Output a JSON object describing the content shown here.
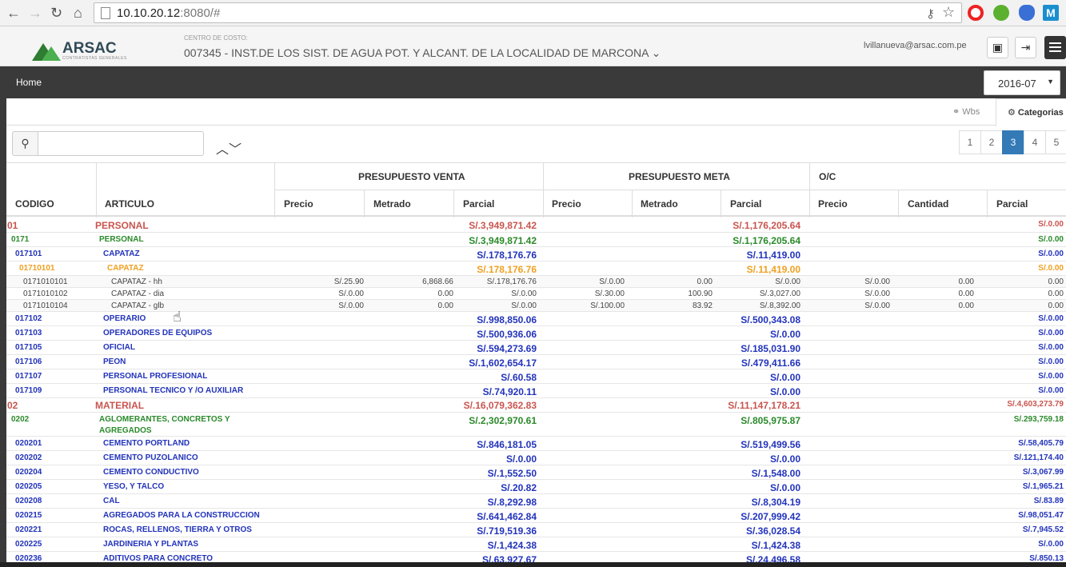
{
  "browser": {
    "url_host": "10.10.20.12",
    "url_rest": ":8080/#"
  },
  "header": {
    "logo_text": "ARSAC",
    "logo_sub": "CONTRATISTAS GENERALES",
    "cc_label": "CENTRO DE COSTO:",
    "cc_name": "007345 - INST.DE LOS SIST. DE AGUA POT. Y ALCANT. DE LA LOCALIDAD DE MARCONA ⌄",
    "email": "lvillanueva@arsac.com.pe"
  },
  "nav": {
    "home": "Home",
    "period": "2016-07"
  },
  "tabs": {
    "wbs": "Wbs",
    "categorias": "Categorias"
  },
  "search": {
    "placeholder": ""
  },
  "pager": [
    "1",
    "2",
    "3",
    "4",
    "5"
  ],
  "pager_active": "3",
  "columns": {
    "codigo": "CODIGO",
    "articulo": "ARTICULO",
    "group_venta": "PRESUPUESTO VENTA",
    "group_meta": "PRESUPUESTO META",
    "group_oc": "O/C",
    "precio": "Precio",
    "metrado": "Metrado",
    "parcial": "Parcial",
    "cantidad": "Cantidad"
  },
  "rows": [
    {
      "level": 1,
      "code": "01",
      "name": "PERSONAL",
      "v_parcial": "S/.3,949,871.42",
      "m_parcial": "S/.1,176,205.64",
      "oc_parcial": "S/.0.00"
    },
    {
      "level": 2,
      "code": "0171",
      "name": "PERSONAL",
      "v_parcial": "S/.3,949,871.42",
      "m_parcial": "S/.1,176,205.64",
      "oc_parcial": "S/.0.00"
    },
    {
      "level": 3,
      "code": "017101",
      "name": "CAPATAZ",
      "v_parcial": "S/.178,176.76",
      "m_parcial": "S/.11,419.00",
      "oc_parcial": "S/.0.00"
    },
    {
      "level": 4,
      "code": "01710101",
      "name": "CAPATAZ",
      "v_parcial": "S/.178,176.76",
      "m_parcial": "S/.11,419.00",
      "oc_parcial": "S/.0.00"
    },
    {
      "level": 5,
      "code": "0171010101",
      "name": "CAPATAZ - hh",
      "v_precio": "S/.25.90",
      "v_metrado": "6,868.66",
      "v_parcial": "S/.178,176.76",
      "m_precio": "S/.0.00",
      "m_metrado": "0.00",
      "m_parcial": "S/.0.00",
      "oc_precio": "S/.0.00",
      "oc_cantidad": "0.00",
      "oc_parcial": "0.00"
    },
    {
      "level": 5,
      "code": "0171010102",
      "name": "CAPATAZ - dia",
      "v_precio": "S/.0.00",
      "v_metrado": "0.00",
      "v_parcial": "S/.0.00",
      "m_precio": "S/.30.00",
      "m_metrado": "100.90",
      "m_parcial": "S/.3,027.00",
      "oc_precio": "S/.0.00",
      "oc_cantidad": "0.00",
      "oc_parcial": "0.00"
    },
    {
      "level": 5,
      "code": "0171010104",
      "name": "CAPATAZ - glb",
      "v_precio": "S/.0.00",
      "v_metrado": "0.00",
      "v_parcial": "S/.0.00",
      "m_precio": "S/.100.00",
      "m_metrado": "83.92",
      "m_parcial": "S/.8,392.00",
      "oc_precio": "S/.0.00",
      "oc_cantidad": "0.00",
      "oc_parcial": "0.00"
    },
    {
      "level": 3,
      "code": "017102",
      "name": "OPERARIO",
      "v_parcial": "S/.998,850.06",
      "m_parcial": "S/.500,343.08",
      "oc_parcial": "S/.0.00"
    },
    {
      "level": 3,
      "code": "017103",
      "name": "OPERADORES DE EQUIPOS",
      "v_parcial": "S/.500,936.06",
      "m_parcial": "S/.0.00",
      "oc_parcial": "S/.0.00"
    },
    {
      "level": 3,
      "code": "017105",
      "name": "OFICIAL",
      "v_parcial": "S/.594,273.69",
      "m_parcial": "S/.185,031.90",
      "oc_parcial": "S/.0.00"
    },
    {
      "level": 3,
      "code": "017106",
      "name": "PEON",
      "v_parcial": "S/.1,602,654.17",
      "m_parcial": "S/.479,411.66",
      "oc_parcial": "S/.0.00"
    },
    {
      "level": 3,
      "code": "017107",
      "name": "PERSONAL PROFESIONAL",
      "v_parcial": "S/.60.58",
      "m_parcial": "S/.0.00",
      "oc_parcial": "S/.0.00"
    },
    {
      "level": 3,
      "code": "017109",
      "name": "PERSONAL TECNICO Y /O AUXILIAR",
      "v_parcial": "S/.74,920.11",
      "m_parcial": "S/.0.00",
      "oc_parcial": "S/.0.00"
    },
    {
      "level": 1,
      "code": "02",
      "name": "MATERIAL",
      "v_parcial": "S/.16,079,362.83",
      "m_parcial": "S/.11,147,178.21",
      "oc_parcial": "S/.4,603,273.79"
    },
    {
      "level": 2,
      "code": "0202",
      "name": "AGLOMERANTES, CONCRETOS Y",
      "name2": "AGREGADOS",
      "v_parcial": "S/.2,302,970.61",
      "m_parcial": "S/.805,975.87",
      "oc_parcial": "S/.293,759.18"
    },
    {
      "level": 3,
      "code": "020201",
      "name": "CEMENTO PORTLAND",
      "v_parcial": "S/.846,181.05",
      "m_parcial": "S/.519,499.56",
      "oc_parcial": "S/.58,405.79"
    },
    {
      "level": 3,
      "code": "020202",
      "name": "CEMENTO PUZOLANICO",
      "v_parcial": "S/.0.00",
      "m_parcial": "S/.0.00",
      "oc_parcial": "S/.121,174.40"
    },
    {
      "level": 3,
      "code": "020204",
      "name": "CEMENTO CONDUCTIVO",
      "v_parcial": "S/.1,552.50",
      "m_parcial": "S/.1,548.00",
      "oc_parcial": "S/.3,067.99"
    },
    {
      "level": 3,
      "code": "020205",
      "name": "YESO, Y TALCO",
      "v_parcial": "S/.20.82",
      "m_parcial": "S/.0.00",
      "oc_parcial": "S/.1,965.21"
    },
    {
      "level": 3,
      "code": "020208",
      "name": "CAL",
      "v_parcial": "S/.8,292.98",
      "m_parcial": "S/.8,304.19",
      "oc_parcial": "S/.83.89"
    },
    {
      "level": 3,
      "code": "020215",
      "name": "AGREGADOS PARA LA CONSTRUCCION",
      "v_parcial": "S/.641,462.84",
      "m_parcial": "S/.207,999.42",
      "oc_parcial": "S/.98,051.47"
    },
    {
      "level": 3,
      "code": "020221",
      "name": "ROCAS, RELLENOS, TIERRA Y OTROS",
      "v_parcial": "S/.719,519.36",
      "m_parcial": "S/.36,028.54",
      "oc_parcial": "S/.7,945.52"
    },
    {
      "level": 3,
      "code": "020225",
      "name": "JARDINERIA Y PLANTAS",
      "v_parcial": "S/.1,424.38",
      "m_parcial": "S/.1,424.38",
      "oc_parcial": "S/.0.00"
    },
    {
      "level": 3,
      "code": "020236",
      "name": "ADITIVOS PARA CONCRETO",
      "v_parcial": "S/.63,927.67",
      "m_parcial": "S/.24,496.58",
      "oc_parcial": "S/.850.13"
    }
  ],
  "colors": {
    "level1": "#c9554f",
    "level2": "#2a8a2a",
    "level3": "#2233bb",
    "level4": "#f0a020",
    "accent": "#337ab7"
  }
}
